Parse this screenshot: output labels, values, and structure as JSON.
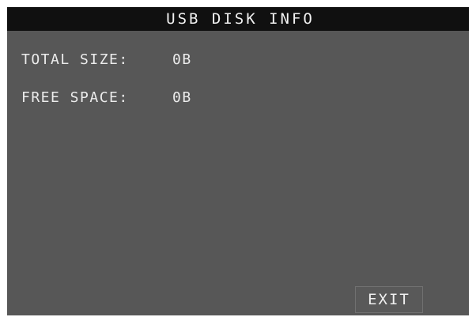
{
  "header": {
    "title": "USB DISK INFO"
  },
  "disk_info": {
    "total_size_label": "TOTAL SIZE:",
    "total_size_value": "0B",
    "free_space_label": "FREE SPACE:",
    "free_space_value": "0B"
  },
  "footer": {
    "exit_label": "EXIT"
  },
  "colors": {
    "title_bar": "#101010",
    "panel_background": "#575757",
    "text": "#ececec"
  }
}
